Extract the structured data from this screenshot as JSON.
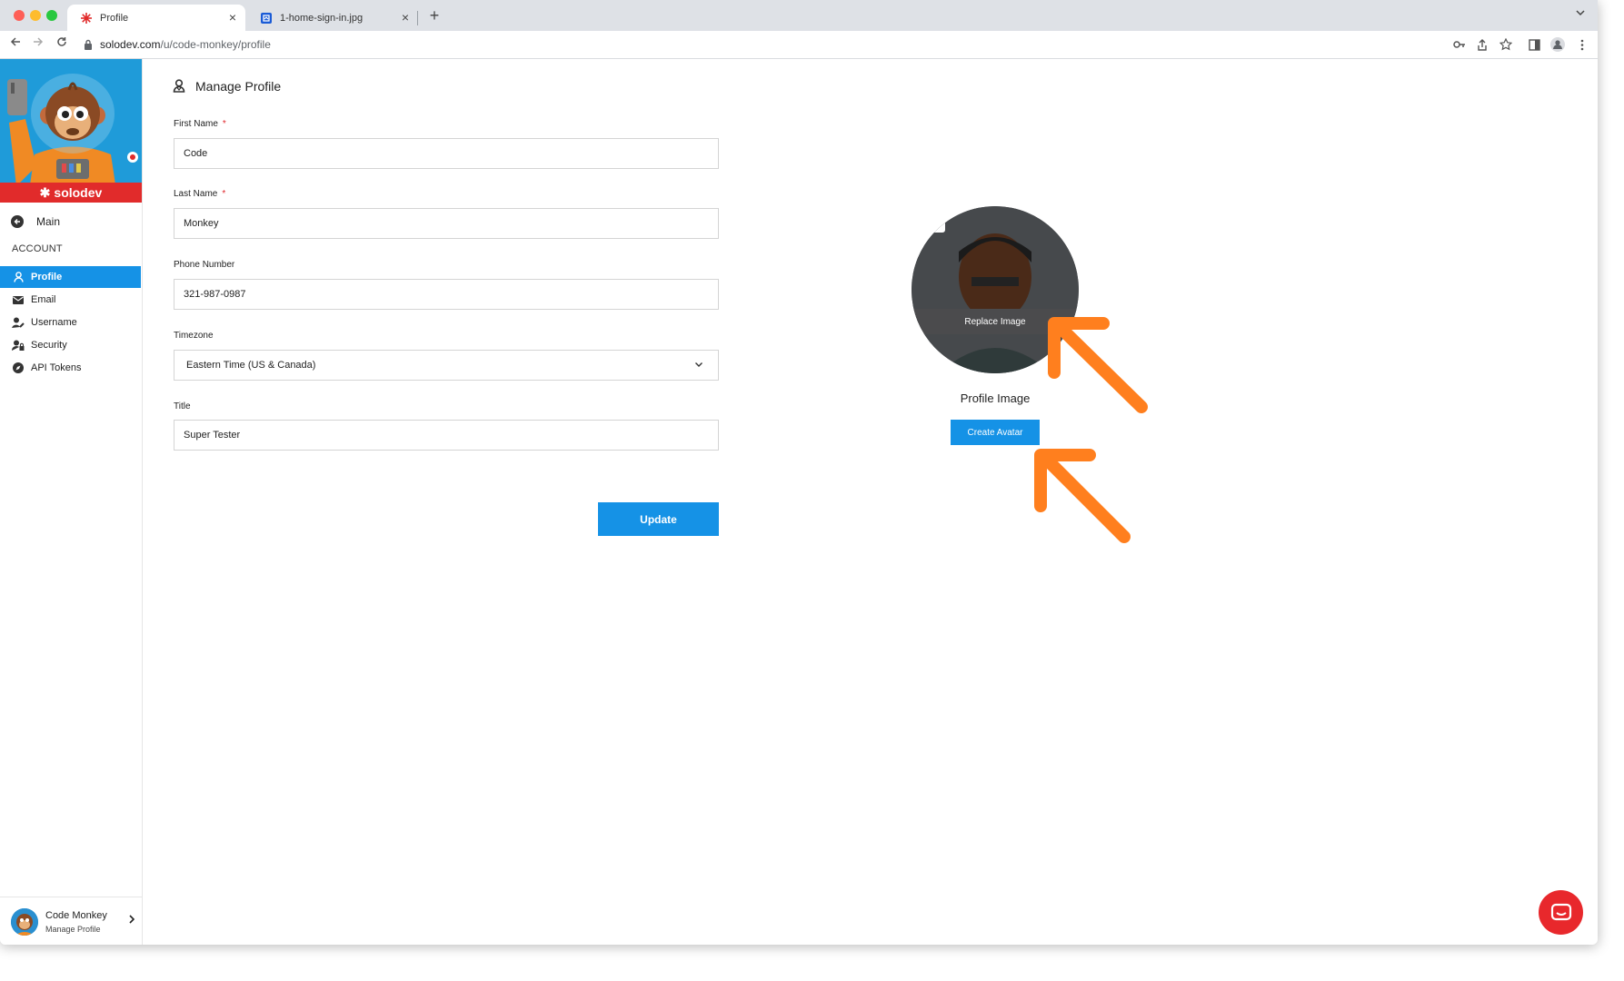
{
  "browser": {
    "tabs": [
      {
        "title": "Profile",
        "active": true
      },
      {
        "title": "1-home-sign-in.jpg",
        "active": false
      }
    ],
    "url_host": "solodev.com",
    "url_path": "/u/code-monkey/profile"
  },
  "sidebar": {
    "brand": "solodev",
    "main_link": "Main",
    "section_label": "ACCOUNT",
    "items": [
      {
        "label": "Profile",
        "icon": "user-icon",
        "active": true
      },
      {
        "label": "Email",
        "icon": "envelope-icon",
        "active": false
      },
      {
        "label": "Username",
        "icon": "user-edit-icon",
        "active": false
      },
      {
        "label": "Security",
        "icon": "user-lock-icon",
        "active": false
      },
      {
        "label": "API Tokens",
        "icon": "compass-icon",
        "active": false
      }
    ],
    "user": {
      "name": "Code Monkey",
      "subtitle": "Manage Profile"
    }
  },
  "form": {
    "title": "Manage Profile",
    "first_name": {
      "label": "First Name",
      "value": "Code",
      "required": true
    },
    "last_name": {
      "label": "Last Name",
      "value": "Monkey",
      "required": true
    },
    "phone": {
      "label": "Phone Number",
      "value": "321-987-0987"
    },
    "timezone": {
      "label": "Timezone",
      "value": "Eastern Time (US & Canada)"
    },
    "title_field": {
      "label": "Title",
      "value": "Super Tester"
    },
    "required_marker": "*",
    "submit_label": "Update"
  },
  "profile_image": {
    "overlay_label": "Replace Image",
    "caption": "Profile Image",
    "button_label": "Create Avatar"
  },
  "colors": {
    "accent": "#1592e6",
    "annotation_arrow": "#ff7f1e",
    "chat": "#e8282c"
  }
}
